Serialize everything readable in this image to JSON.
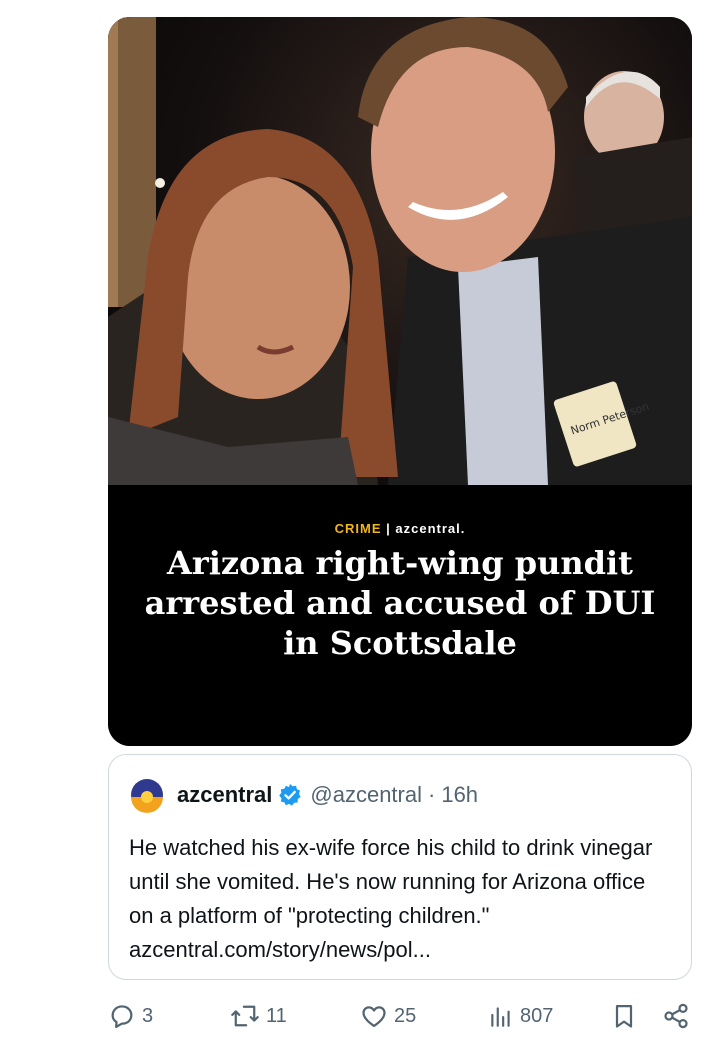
{
  "article": {
    "section": "CRIME",
    "separator": "|",
    "source": "azcentral.",
    "headline": "Arizona right-wing pundit arrested and accused of DUI in Scottsdale",
    "name_tag": "Norm Peterson"
  },
  "quote": {
    "name": "azcentral",
    "handle": "@azcentral",
    "dot": "·",
    "time": "16h",
    "text": "He watched his ex-wife force his child to drink vinegar until she vomited. He's now running for Arizona office on a platform of \"protecting children.\" azcentral.com/story/news/pol..."
  },
  "actions": {
    "replies": "3",
    "reposts": "11",
    "likes": "25",
    "views": "807"
  },
  "colors": {
    "verified": "#1d9bf0",
    "kicker": "#f2b51c",
    "muted": "#536471"
  }
}
